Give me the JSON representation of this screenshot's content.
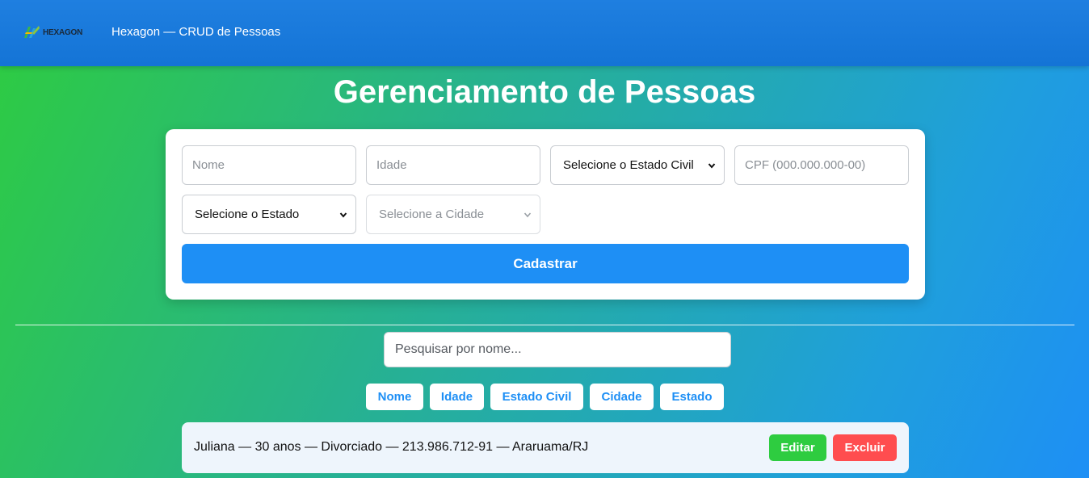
{
  "header": {
    "logo_text": "HEXAGON",
    "app_title": "Hexagon — CRUD de Pessoas"
  },
  "page": {
    "title": "Gerenciamento de Pessoas"
  },
  "form": {
    "nome_placeholder": "Nome",
    "idade_placeholder": "Idade",
    "estado_civil_selected": "Selecione o Estado Civil",
    "cpf_placeholder": "CPF (000.000.000-00)",
    "estado_selected": "Selecione o Estado",
    "cidade_selected": "Selecione a Cidade",
    "submit_label": "Cadastrar"
  },
  "search": {
    "placeholder": "Pesquisar por nome..."
  },
  "sort_buttons": [
    "Nome",
    "Idade",
    "Estado Civil",
    "Cidade",
    "Estado"
  ],
  "people": [
    {
      "summary": "Juliana — 30 anos — Divorciado — 213.986.712-91 — Araruama/RJ",
      "edit_label": "Editar",
      "delete_label": "Excluir"
    }
  ],
  "colors": {
    "header": "#1474d6",
    "primary": "#1e8ff5",
    "edit": "#2ecc40",
    "delete": "#ff4d4f"
  }
}
